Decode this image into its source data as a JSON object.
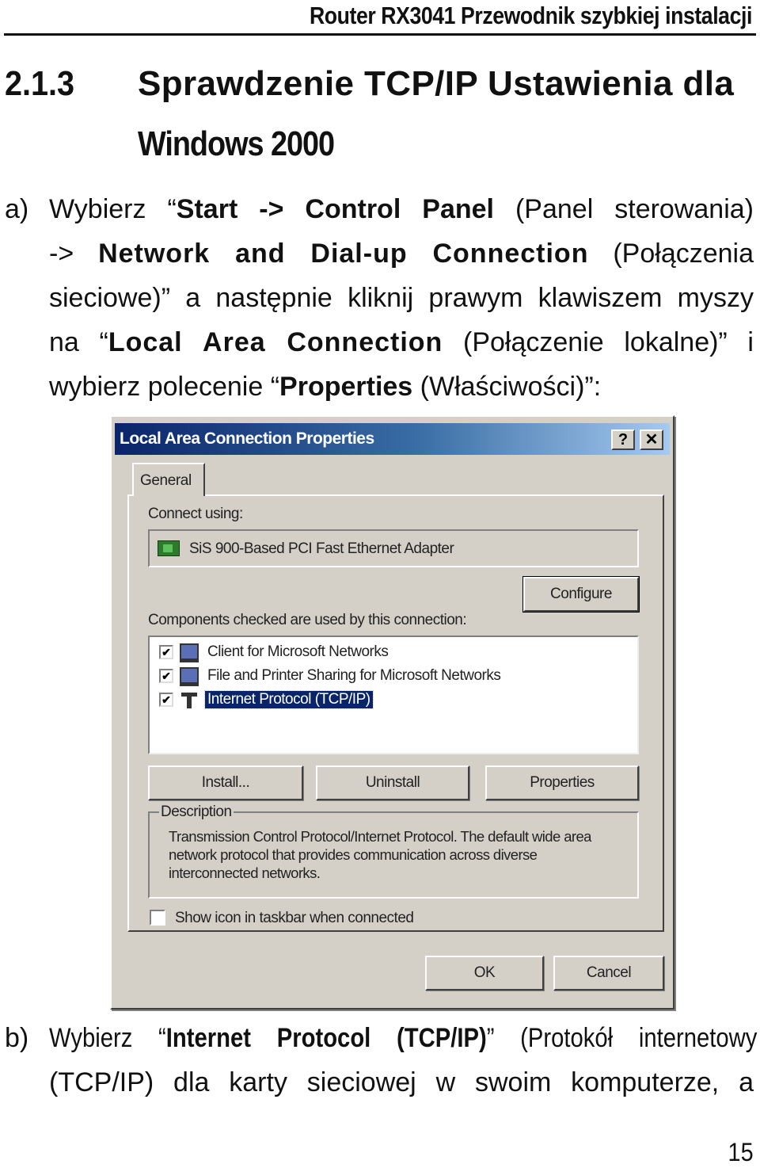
{
  "header": {
    "running_title": "Router RX3041 Przewodnik szybkiej instalacji"
  },
  "section": {
    "number": "2.1.3",
    "title_line1": "Sprawdzenie TCP/IP Ustawienia dla",
    "title_line2": "Windows 2000"
  },
  "step_a": {
    "marker": "a)",
    "line1": {
      "t1": "Wybierz “",
      "b1": "Start -> Control Panel",
      "t2": " (Panel sterowania)"
    },
    "line2": {
      "t1": "-> ",
      "b1": "Network and Dial-up Connection",
      "t2": " (Połączenia"
    },
    "line3": {
      "t1": "sieciowe)” a następnie kliknij prawym klawiszem myszy"
    },
    "line4": {
      "t1": "na “",
      "b1": "Local Area Connection",
      "t2": " (Połączenie lokalne)” i"
    },
    "line5": {
      "t1": "wybierz polecenie “",
      "b1": "Properties",
      "t2": " (Właściwości)”:"
    }
  },
  "dialog": {
    "title": "Local Area Connection Properties",
    "help_button": "?",
    "close_button": "✕",
    "tab_general": "General",
    "connect_using_label": "Connect using:",
    "adapter_icon": "network-adapter-icon",
    "adapter_name": "SiS 900-Based PCI Fast Ethernet Adapter",
    "configure_button": "Configure",
    "components_label": "Components checked are used by this connection:",
    "components": [
      {
        "label": "Client for Microsoft Networks",
        "checked": "✔",
        "icon": "client-network-icon",
        "selected": false
      },
      {
        "label": "File and Printer Sharing for Microsoft Networks",
        "checked": "✔",
        "icon": "file-printer-sharing-icon",
        "selected": false
      },
      {
        "label": "Internet Protocol (TCP/IP)",
        "checked": "✔",
        "icon": "protocol-icon",
        "selected": true
      }
    ],
    "install_button": "Install...",
    "uninstall_button": "Uninstall",
    "properties_button": "Properties",
    "description_legend": "Description",
    "description_text": "Transmission Control Protocol/Internet Protocol. The default wide area network protocol that provides communication across diverse interconnected networks.",
    "show_icon_label": "Show icon in taskbar when connected",
    "show_icon_checked": false,
    "ok_button": "OK",
    "cancel_button": "Cancel",
    "colors": {
      "titlebar_start": "#0a246a",
      "titlebar_end": "#a6caf0",
      "face": "#d4d0c8",
      "selection": "#0a246a"
    }
  },
  "step_b": {
    "marker": "b)",
    "line1": {
      "t1": "Wybierz “",
      "b1": "Internet Protocol (TCP/IP)",
      "t2": "” (Protokół internetowy"
    },
    "line2": {
      "t1": "(TCP/IP) dla karty sieciowej w swoim komputerze, a"
    }
  },
  "footer": {
    "page_number": "15"
  }
}
